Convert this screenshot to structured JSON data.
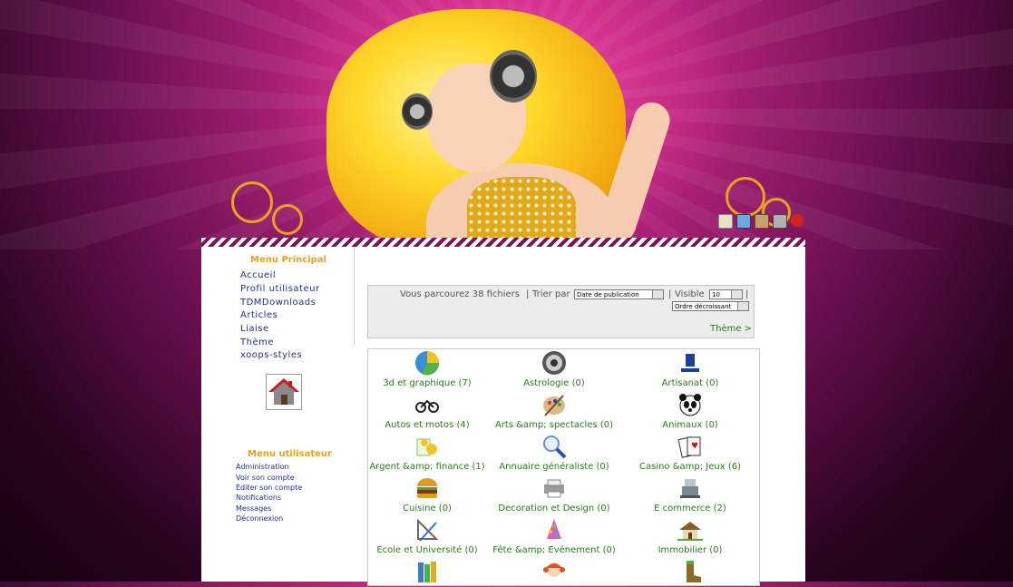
{
  "header": {
    "toolbar_icons": [
      "notes-icon",
      "users-icon",
      "images-icon",
      "tools-icon",
      "power-icon"
    ]
  },
  "main_menu": {
    "title": "Menu Principal",
    "items": [
      "Accueil",
      "Profil utilisateur",
      "TDMDownloads",
      "Articles",
      "Liaise",
      "Thème",
      "xoops-styles"
    ]
  },
  "user_menu": {
    "title": "Menu utilisateur",
    "items": [
      "Administration",
      "Voir son compte",
      "Editer son compte",
      "Notifications",
      "Messages",
      "Déconnexion"
    ]
  },
  "sort_bar": {
    "browsing_text": "Vous parcourez 38 fichiers",
    "separator": "|",
    "sort_label": "Trier par",
    "sort_value": "Date de publication",
    "visible_label": "Visible",
    "visible_value": "10",
    "order_value": "Ordre décroissant",
    "theme_link": "Thème >"
  },
  "categories": [
    {
      "label": "3d et graphique (7)",
      "icon": "pie-chart-icon"
    },
    {
      "label": "Astrologie (0)",
      "icon": "crab-icon"
    },
    {
      "label": "Artisanat (0)",
      "icon": "artisan-logo-icon"
    },
    {
      "label": "Autos et motos (4)",
      "icon": "motorcycle-icon"
    },
    {
      "label": "Arts &amp; spectacles (0)",
      "icon": "palette-icon"
    },
    {
      "label": "Animaux (0)",
      "icon": "panda-icon"
    },
    {
      "label": "Argent &amp; finance (1)",
      "icon": "money-icon"
    },
    {
      "label": "Annuaire généraliste (0)",
      "icon": "magnifier-icon"
    },
    {
      "label": "Casino &amp; Jeux (6)",
      "icon": "cards-icon"
    },
    {
      "label": "Cuisine (0)",
      "icon": "burger-icon"
    },
    {
      "label": "Decoration et Design (0)",
      "icon": "printer-icon"
    },
    {
      "label": "E commerce (2)",
      "icon": "cash-register-icon"
    },
    {
      "label": "Ecole et Université (0)",
      "icon": "drafting-icon"
    },
    {
      "label": "Fête &amp; Evénement (0)",
      "icon": "party-icon"
    },
    {
      "label": "Immobilier (0)",
      "icon": "house-icon"
    },
    {
      "label": "",
      "icon": "books-icon"
    },
    {
      "label": "",
      "icon": "girl-icon"
    },
    {
      "label": "",
      "icon": "boot-icon"
    }
  ]
}
